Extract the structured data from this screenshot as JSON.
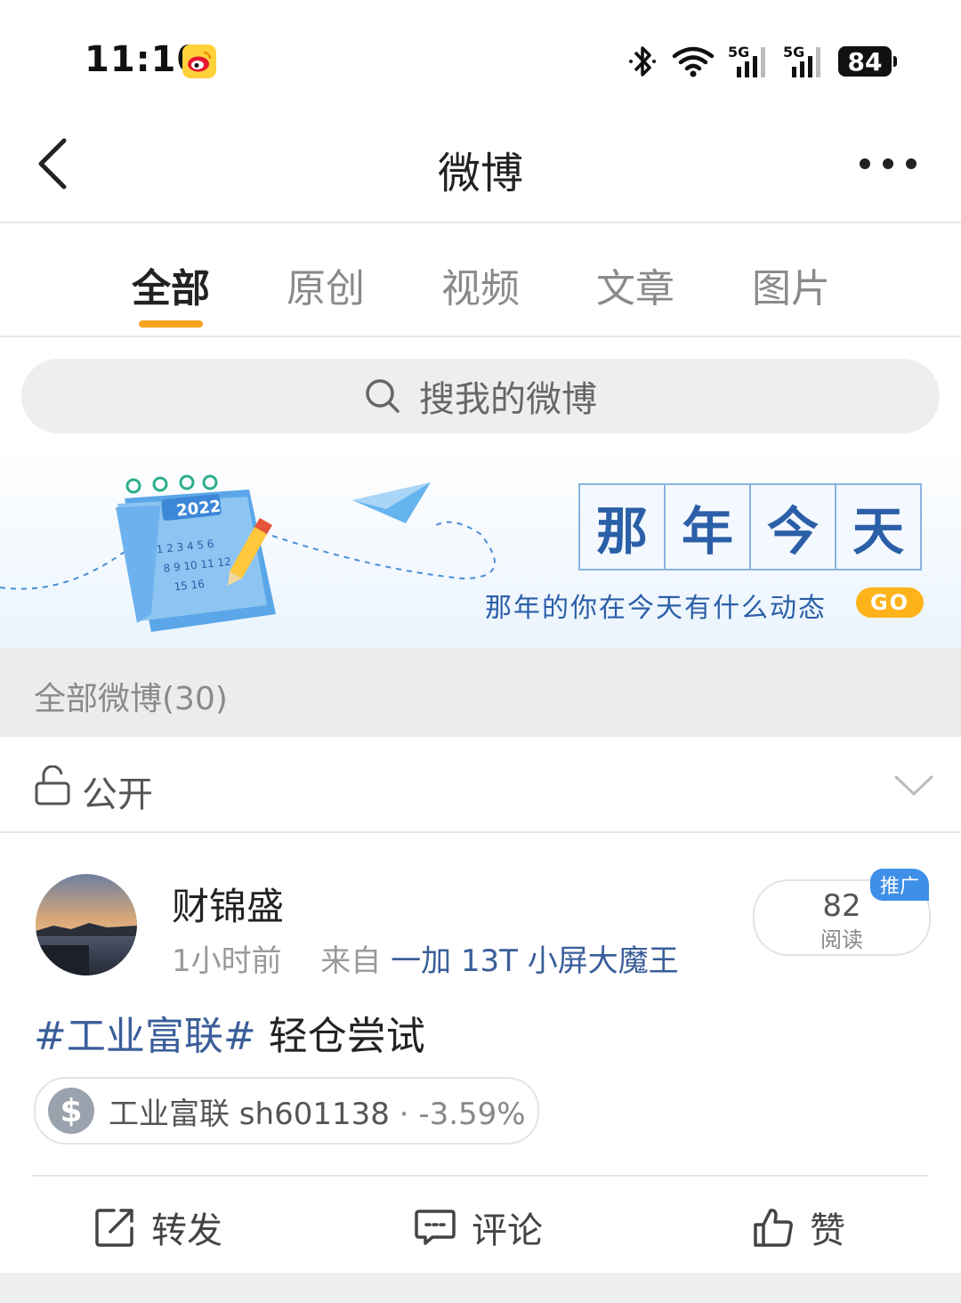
{
  "status_bar": {
    "time": "11:10",
    "network_1": "5G",
    "network_2": "5G",
    "battery": "84"
  },
  "nav": {
    "title": "微博"
  },
  "tabs": [
    {
      "label": "全部",
      "active": true
    },
    {
      "label": "原创",
      "active": false
    },
    {
      "label": "视频",
      "active": false
    },
    {
      "label": "文章",
      "active": false
    },
    {
      "label": "图片",
      "active": false
    }
  ],
  "search": {
    "placeholder": "搜我的微博"
  },
  "banner": {
    "year": "2022",
    "title_chars": [
      "那",
      "年",
      "今",
      "天"
    ],
    "subtitle": "那年的你在今天有什么动态",
    "go_label": "GO"
  },
  "section": {
    "title": "全部微博(30)"
  },
  "filter": {
    "label": "公开"
  },
  "post": {
    "author": "财锦盛",
    "time": "1小时前",
    "from_prefix": "来自",
    "source": "一加 13T 小屏大魔王",
    "reads_count": "82",
    "reads_label": "阅读",
    "promo_label": "推广",
    "topic": "#工业富联#",
    "text": " 轻仓尝试",
    "stock": {
      "icon_symbol": "$",
      "name": "工业富联 sh601138",
      "separator": " · ",
      "change": "-3.59%"
    }
  },
  "actions": {
    "repost": "转发",
    "comment": "评论",
    "like": "赞"
  },
  "colors": {
    "accent": "#f8a31d",
    "link": "#3a5e99",
    "promo": "#3d8fe8",
    "banner_text": "#2b5fa8"
  }
}
